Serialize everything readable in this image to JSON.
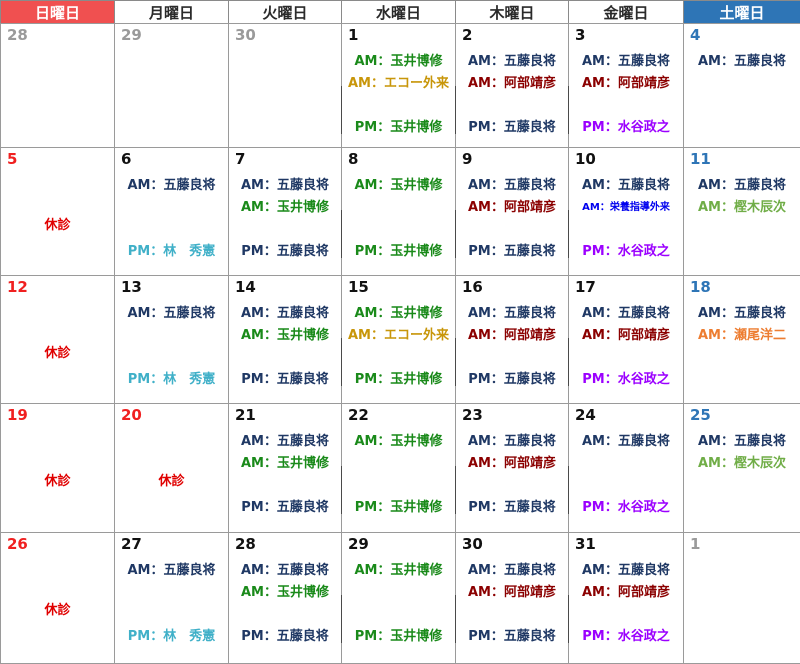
{
  "colors": {
    "sunday": "#f02020",
    "saturday": "#2e75b6",
    "weekday": "#111111",
    "muted": "#9a9a9a",
    "holiday": "#e00000",
    "gotou": "#1f3864",
    "tamai": "#1a8a1a",
    "echo": "#c8960a",
    "abe": "#8b0000",
    "mizutani": "#9b00ff",
    "hayashi": "#40b0c8",
    "kashiwagi": "#70ad47",
    "seo": "#ed7d31",
    "eiyou": "#0000ee"
  },
  "headers": [
    "日曜日",
    "月曜日",
    "火曜日",
    "水曜日",
    "木曜日",
    "金曜日",
    "土曜日"
  ],
  "weeks": [
    [
      {
        "day": "28",
        "c": "muted",
        "e": []
      },
      {
        "day": "29",
        "c": "muted",
        "e": []
      },
      {
        "day": "30",
        "c": "muted",
        "e": []
      },
      {
        "day": "1",
        "c": "weekday",
        "e": [
          {
            "t": "AM：玉井博修",
            "c": "tamai",
            "s": 0
          },
          {
            "t": "AM：エコー外来",
            "c": "echo",
            "s": 1
          },
          {
            "t": "PM：玉井博修",
            "c": "tamai",
            "s": 3
          }
        ]
      },
      {
        "day": "2",
        "c": "weekday",
        "e": [
          {
            "t": "AM：五藤良将",
            "c": "gotou",
            "s": 0
          },
          {
            "t": "AM：阿部靖彦",
            "c": "abe",
            "s": 1
          },
          {
            "t": "PM：五藤良将",
            "c": "gotou",
            "s": 3
          }
        ]
      },
      {
        "day": "3",
        "c": "weekday",
        "e": [
          {
            "t": "AM：五藤良将",
            "c": "gotou",
            "s": 0
          },
          {
            "t": "AM：阿部靖彦",
            "c": "abe",
            "s": 1
          },
          {
            "t": "PM：水谷政之",
            "c": "mizutani",
            "s": 3
          }
        ]
      },
      {
        "day": "4",
        "c": "saturday",
        "e": [
          {
            "t": "AM：五藤良将",
            "c": "gotou",
            "s": 0
          }
        ]
      }
    ],
    [
      {
        "day": "5",
        "c": "sunday",
        "holiday": "休診"
      },
      {
        "day": "6",
        "c": "weekday",
        "e": [
          {
            "t": "AM：五藤良将",
            "c": "gotou",
            "s": 0
          },
          {
            "t": "PM：林　秀憲",
            "c": "hayashi",
            "s": 3
          }
        ]
      },
      {
        "day": "7",
        "c": "weekday",
        "e": [
          {
            "t": "AM：五藤良将",
            "c": "gotou",
            "s": 0
          },
          {
            "t": "AM：玉井博修",
            "c": "tamai",
            "s": 1
          },
          {
            "t": "PM：五藤良将",
            "c": "gotou",
            "s": 3
          }
        ]
      },
      {
        "day": "8",
        "c": "weekday",
        "e": [
          {
            "t": "AM：玉井博修",
            "c": "tamai",
            "s": 0
          },
          {
            "t": "PM：玉井博修",
            "c": "tamai",
            "s": 3
          }
        ]
      },
      {
        "day": "9",
        "c": "weekday",
        "e": [
          {
            "t": "AM：五藤良将",
            "c": "gotou",
            "s": 0
          },
          {
            "t": "AM：阿部靖彦",
            "c": "abe",
            "s": 1
          },
          {
            "t": "PM：五藤良将",
            "c": "gotou",
            "s": 3
          }
        ]
      },
      {
        "day": "10",
        "c": "weekday",
        "e": [
          {
            "t": "AM：五藤良将",
            "c": "gotou",
            "s": 0
          },
          {
            "t": "AM：栄養指導外来",
            "c": "eiyou",
            "s": 1,
            "small": true
          },
          {
            "t": "PM：水谷政之",
            "c": "mizutani",
            "s": 3
          }
        ]
      },
      {
        "day": "11",
        "c": "saturday",
        "e": [
          {
            "t": "AM：五藤良将",
            "c": "gotou",
            "s": 0
          },
          {
            "t": "AM：樫木辰次",
            "c": "kashiwagi",
            "s": 1
          }
        ]
      }
    ],
    [
      {
        "day": "12",
        "c": "sunday",
        "holiday": "休診"
      },
      {
        "day": "13",
        "c": "weekday",
        "e": [
          {
            "t": "AM：五藤良将",
            "c": "gotou",
            "s": 0
          },
          {
            "t": "PM：林　秀憲",
            "c": "hayashi",
            "s": 3
          }
        ]
      },
      {
        "day": "14",
        "c": "weekday",
        "e": [
          {
            "t": "AM：五藤良将",
            "c": "gotou",
            "s": 0
          },
          {
            "t": "AM：玉井博修",
            "c": "tamai",
            "s": 1
          },
          {
            "t": "PM：五藤良将",
            "c": "gotou",
            "s": 3
          }
        ]
      },
      {
        "day": "15",
        "c": "weekday",
        "e": [
          {
            "t": "AM：玉井博修",
            "c": "tamai",
            "s": 0
          },
          {
            "t": "AM：エコー外来",
            "c": "echo",
            "s": 1
          },
          {
            "t": "PM：玉井博修",
            "c": "tamai",
            "s": 3
          }
        ]
      },
      {
        "day": "16",
        "c": "weekday",
        "e": [
          {
            "t": "AM：五藤良将",
            "c": "gotou",
            "s": 0
          },
          {
            "t": "AM：阿部靖彦",
            "c": "abe",
            "s": 1
          },
          {
            "t": "PM：五藤良将",
            "c": "gotou",
            "s": 3
          }
        ]
      },
      {
        "day": "17",
        "c": "weekday",
        "e": [
          {
            "t": "AM：五藤良将",
            "c": "gotou",
            "s": 0
          },
          {
            "t": "AM：阿部靖彦",
            "c": "abe",
            "s": 1
          },
          {
            "t": "PM：水谷政之",
            "c": "mizutani",
            "s": 3
          }
        ]
      },
      {
        "day": "18",
        "c": "saturday",
        "e": [
          {
            "t": "AM：五藤良将",
            "c": "gotou",
            "s": 0
          },
          {
            "t": "AM：瀬尾洋二",
            "c": "seo",
            "s": 1
          }
        ]
      }
    ],
    [
      {
        "day": "19",
        "c": "sunday",
        "holiday": "休診"
      },
      {
        "day": "20",
        "c": "sunday",
        "holiday": "休診"
      },
      {
        "day": "21",
        "c": "weekday",
        "e": [
          {
            "t": "AM：五藤良将",
            "c": "gotou",
            "s": 0
          },
          {
            "t": "AM：玉井博修",
            "c": "tamai",
            "s": 1
          },
          {
            "t": "PM：五藤良将",
            "c": "gotou",
            "s": 3
          }
        ]
      },
      {
        "day": "22",
        "c": "weekday",
        "e": [
          {
            "t": "AM：玉井博修",
            "c": "tamai",
            "s": 0
          },
          {
            "t": "PM：玉井博修",
            "c": "tamai",
            "s": 3
          }
        ]
      },
      {
        "day": "23",
        "c": "weekday",
        "e": [
          {
            "t": "AM：五藤良将",
            "c": "gotou",
            "s": 0
          },
          {
            "t": "AM：阿部靖彦",
            "c": "abe",
            "s": 1
          },
          {
            "t": "PM：五藤良将",
            "c": "gotou",
            "s": 3
          }
        ]
      },
      {
        "day": "24",
        "c": "weekday",
        "e": [
          {
            "t": "AM：五藤良将",
            "c": "gotou",
            "s": 0
          },
          {
            "t": "PM：水谷政之",
            "c": "mizutani",
            "s": 3
          }
        ]
      },
      {
        "day": "25",
        "c": "saturday",
        "e": [
          {
            "t": "AM：五藤良将",
            "c": "gotou",
            "s": 0
          },
          {
            "t": "AM：樫木辰次",
            "c": "kashiwagi",
            "s": 1
          }
        ]
      }
    ],
    [
      {
        "day": "26",
        "c": "sunday",
        "holiday": "休診"
      },
      {
        "day": "27",
        "c": "weekday",
        "e": [
          {
            "t": "AM：五藤良将",
            "c": "gotou",
            "s": 0
          },
          {
            "t": "PM：林　秀憲",
            "c": "hayashi",
            "s": 3
          }
        ]
      },
      {
        "day": "28",
        "c": "weekday",
        "e": [
          {
            "t": "AM：五藤良将",
            "c": "gotou",
            "s": 0
          },
          {
            "t": "AM：玉井博修",
            "c": "tamai",
            "s": 1
          },
          {
            "t": "PM：五藤良将",
            "c": "gotou",
            "s": 3
          }
        ]
      },
      {
        "day": "29",
        "c": "weekday",
        "e": [
          {
            "t": "AM：玉井博修",
            "c": "tamai",
            "s": 0
          },
          {
            "t": "PM：玉井博修",
            "c": "tamai",
            "s": 3
          }
        ]
      },
      {
        "day": "30",
        "c": "weekday",
        "e": [
          {
            "t": "AM：五藤良将",
            "c": "gotou",
            "s": 0
          },
          {
            "t": "AM：阿部靖彦",
            "c": "abe",
            "s": 1
          },
          {
            "t": "PM：五藤良将",
            "c": "gotou",
            "s": 3
          }
        ]
      },
      {
        "day": "31",
        "c": "weekday",
        "e": [
          {
            "t": "AM：五藤良将",
            "c": "gotou",
            "s": 0
          },
          {
            "t": "AM：阿部靖彦",
            "c": "abe",
            "s": 1
          },
          {
            "t": "PM：水谷政之",
            "c": "mizutani",
            "s": 3
          }
        ]
      },
      {
        "day": "1",
        "c": "muted",
        "e": []
      }
    ]
  ]
}
